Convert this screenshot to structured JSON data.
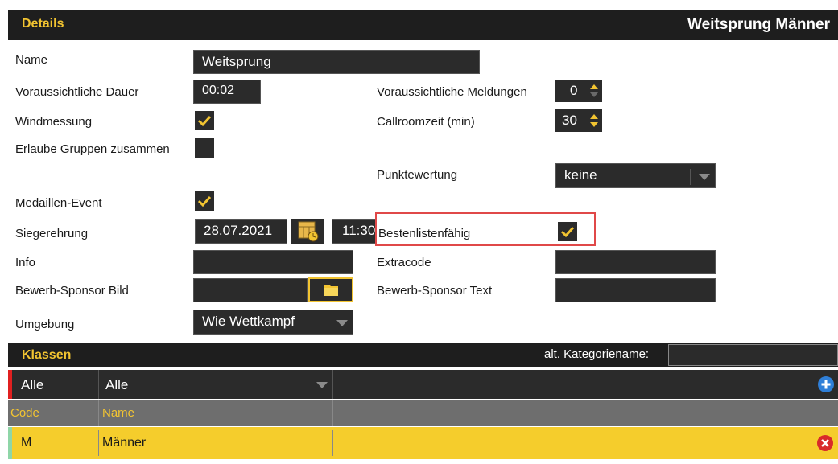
{
  "header": {
    "section_title": "Details",
    "event_title": "Weitsprung Männer"
  },
  "form": {
    "name_label": "Name",
    "name_value": "Weitsprung",
    "dauer_label": "Voraussichtliche Dauer",
    "dauer_value": "00:02",
    "meldungen_label": "Voraussichtliche Meldungen",
    "meldungen_value": "0",
    "windmessung_label": "Windmessung",
    "callroom_label": "Callroomzeit (min)",
    "callroom_value": "30",
    "gruppen_label": "Erlaube Gruppen zusammen",
    "punkte_label": "Punktewertung",
    "punkte_value": "keine",
    "medaillen_label": "Medaillen-Event",
    "sieger_label": "Siegerehrung",
    "sieger_date": "28.07.2021",
    "sieger_time": "11:30",
    "besten_label": "Bestenlistenfähig",
    "info_label": "Info",
    "info_value": "",
    "extracode_label": "Extracode",
    "extracode_value": "",
    "sponsor_bild_label": "Bewerb-Sponsor Bild",
    "sponsor_bild_value": "",
    "sponsor_text_label": "Bewerb-Sponsor Text",
    "sponsor_text_value": "",
    "umgebung_label": "Umgebung",
    "umgebung_value": "Wie Wettkampf"
  },
  "checks": {
    "windmessung": true,
    "gruppen": false,
    "medaillen": true,
    "besten": true
  },
  "klassen": {
    "title": "Klassen",
    "alt_label": "alt. Kategoriename:",
    "alt_value": "",
    "filter_first": "Alle",
    "filter_second": "Alle",
    "columns": [
      "Code",
      "Name"
    ],
    "rows": [
      {
        "code": "M",
        "name": "Männer"
      }
    ]
  },
  "icons": [
    "calendar-clock-icon",
    "folder-icon",
    "add-icon",
    "delete-icon",
    "check-icon",
    "spin-arrows-icon",
    "dropdown-arrow-icon"
  ],
  "colors": {
    "accent": "#f2c431",
    "dark": "#1e1e1e",
    "field": "#2b2b2b",
    "highlight": "#e04848"
  }
}
